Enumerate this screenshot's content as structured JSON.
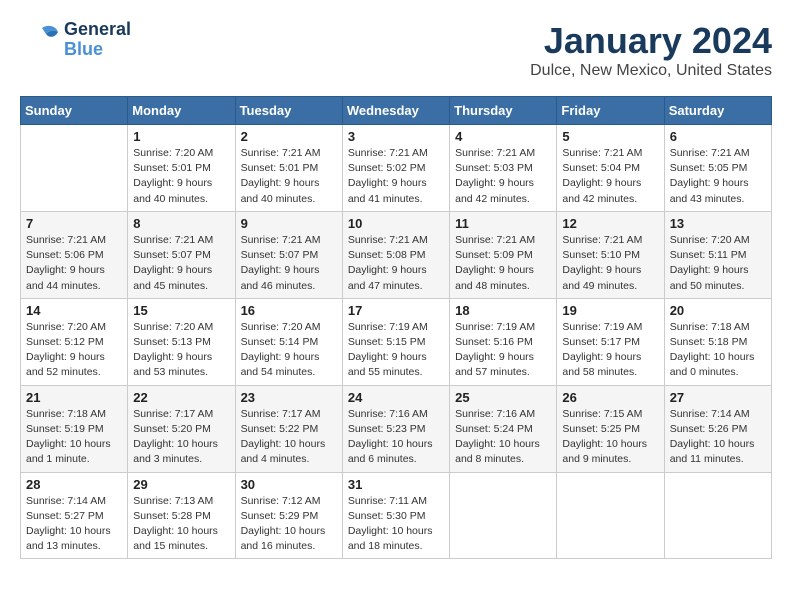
{
  "header": {
    "logo_general": "General",
    "logo_blue": "Blue",
    "month_title": "January 2024",
    "location": "Dulce, New Mexico, United States"
  },
  "days_of_week": [
    "Sunday",
    "Monday",
    "Tuesday",
    "Wednesday",
    "Thursday",
    "Friday",
    "Saturday"
  ],
  "weeks": [
    [
      {
        "day": "",
        "sunrise": "",
        "sunset": "",
        "daylight": ""
      },
      {
        "day": "1",
        "sunrise": "Sunrise: 7:20 AM",
        "sunset": "Sunset: 5:01 PM",
        "daylight": "Daylight: 9 hours and 40 minutes."
      },
      {
        "day": "2",
        "sunrise": "Sunrise: 7:21 AM",
        "sunset": "Sunset: 5:01 PM",
        "daylight": "Daylight: 9 hours and 40 minutes."
      },
      {
        "day": "3",
        "sunrise": "Sunrise: 7:21 AM",
        "sunset": "Sunset: 5:02 PM",
        "daylight": "Daylight: 9 hours and 41 minutes."
      },
      {
        "day": "4",
        "sunrise": "Sunrise: 7:21 AM",
        "sunset": "Sunset: 5:03 PM",
        "daylight": "Daylight: 9 hours and 42 minutes."
      },
      {
        "day": "5",
        "sunrise": "Sunrise: 7:21 AM",
        "sunset": "Sunset: 5:04 PM",
        "daylight": "Daylight: 9 hours and 42 minutes."
      },
      {
        "day": "6",
        "sunrise": "Sunrise: 7:21 AM",
        "sunset": "Sunset: 5:05 PM",
        "daylight": "Daylight: 9 hours and 43 minutes."
      }
    ],
    [
      {
        "day": "7",
        "sunrise": "Sunrise: 7:21 AM",
        "sunset": "Sunset: 5:06 PM",
        "daylight": "Daylight: 9 hours and 44 minutes."
      },
      {
        "day": "8",
        "sunrise": "Sunrise: 7:21 AM",
        "sunset": "Sunset: 5:07 PM",
        "daylight": "Daylight: 9 hours and 45 minutes."
      },
      {
        "day": "9",
        "sunrise": "Sunrise: 7:21 AM",
        "sunset": "Sunset: 5:07 PM",
        "daylight": "Daylight: 9 hours and 46 minutes."
      },
      {
        "day": "10",
        "sunrise": "Sunrise: 7:21 AM",
        "sunset": "Sunset: 5:08 PM",
        "daylight": "Daylight: 9 hours and 47 minutes."
      },
      {
        "day": "11",
        "sunrise": "Sunrise: 7:21 AM",
        "sunset": "Sunset: 5:09 PM",
        "daylight": "Daylight: 9 hours and 48 minutes."
      },
      {
        "day": "12",
        "sunrise": "Sunrise: 7:21 AM",
        "sunset": "Sunset: 5:10 PM",
        "daylight": "Daylight: 9 hours and 49 minutes."
      },
      {
        "day": "13",
        "sunrise": "Sunrise: 7:20 AM",
        "sunset": "Sunset: 5:11 PM",
        "daylight": "Daylight: 9 hours and 50 minutes."
      }
    ],
    [
      {
        "day": "14",
        "sunrise": "Sunrise: 7:20 AM",
        "sunset": "Sunset: 5:12 PM",
        "daylight": "Daylight: 9 hours and 52 minutes."
      },
      {
        "day": "15",
        "sunrise": "Sunrise: 7:20 AM",
        "sunset": "Sunset: 5:13 PM",
        "daylight": "Daylight: 9 hours and 53 minutes."
      },
      {
        "day": "16",
        "sunrise": "Sunrise: 7:20 AM",
        "sunset": "Sunset: 5:14 PM",
        "daylight": "Daylight: 9 hours and 54 minutes."
      },
      {
        "day": "17",
        "sunrise": "Sunrise: 7:19 AM",
        "sunset": "Sunset: 5:15 PM",
        "daylight": "Daylight: 9 hours and 55 minutes."
      },
      {
        "day": "18",
        "sunrise": "Sunrise: 7:19 AM",
        "sunset": "Sunset: 5:16 PM",
        "daylight": "Daylight: 9 hours and 57 minutes."
      },
      {
        "day": "19",
        "sunrise": "Sunrise: 7:19 AM",
        "sunset": "Sunset: 5:17 PM",
        "daylight": "Daylight: 9 hours and 58 minutes."
      },
      {
        "day": "20",
        "sunrise": "Sunrise: 7:18 AM",
        "sunset": "Sunset: 5:18 PM",
        "daylight": "Daylight: 10 hours and 0 minutes."
      }
    ],
    [
      {
        "day": "21",
        "sunrise": "Sunrise: 7:18 AM",
        "sunset": "Sunset: 5:19 PM",
        "daylight": "Daylight: 10 hours and 1 minute."
      },
      {
        "day": "22",
        "sunrise": "Sunrise: 7:17 AM",
        "sunset": "Sunset: 5:20 PM",
        "daylight": "Daylight: 10 hours and 3 minutes."
      },
      {
        "day": "23",
        "sunrise": "Sunrise: 7:17 AM",
        "sunset": "Sunset: 5:22 PM",
        "daylight": "Daylight: 10 hours and 4 minutes."
      },
      {
        "day": "24",
        "sunrise": "Sunrise: 7:16 AM",
        "sunset": "Sunset: 5:23 PM",
        "daylight": "Daylight: 10 hours and 6 minutes."
      },
      {
        "day": "25",
        "sunrise": "Sunrise: 7:16 AM",
        "sunset": "Sunset: 5:24 PM",
        "daylight": "Daylight: 10 hours and 8 minutes."
      },
      {
        "day": "26",
        "sunrise": "Sunrise: 7:15 AM",
        "sunset": "Sunset: 5:25 PM",
        "daylight": "Daylight: 10 hours and 9 minutes."
      },
      {
        "day": "27",
        "sunrise": "Sunrise: 7:14 AM",
        "sunset": "Sunset: 5:26 PM",
        "daylight": "Daylight: 10 hours and 11 minutes."
      }
    ],
    [
      {
        "day": "28",
        "sunrise": "Sunrise: 7:14 AM",
        "sunset": "Sunset: 5:27 PM",
        "daylight": "Daylight: 10 hours and 13 minutes."
      },
      {
        "day": "29",
        "sunrise": "Sunrise: 7:13 AM",
        "sunset": "Sunset: 5:28 PM",
        "daylight": "Daylight: 10 hours and 15 minutes."
      },
      {
        "day": "30",
        "sunrise": "Sunrise: 7:12 AM",
        "sunset": "Sunset: 5:29 PM",
        "daylight": "Daylight: 10 hours and 16 minutes."
      },
      {
        "day": "31",
        "sunrise": "Sunrise: 7:11 AM",
        "sunset": "Sunset: 5:30 PM",
        "daylight": "Daylight: 10 hours and 18 minutes."
      },
      {
        "day": "",
        "sunrise": "",
        "sunset": "",
        "daylight": ""
      },
      {
        "day": "",
        "sunrise": "",
        "sunset": "",
        "daylight": ""
      },
      {
        "day": "",
        "sunrise": "",
        "sunset": "",
        "daylight": ""
      }
    ]
  ]
}
